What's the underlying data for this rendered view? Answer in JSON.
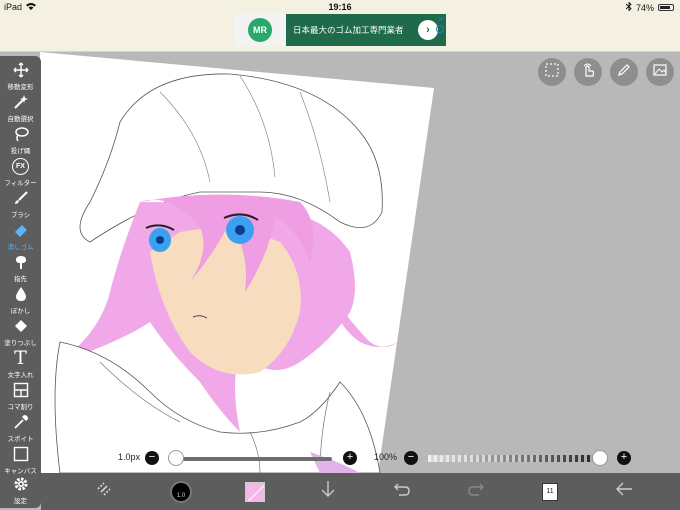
{
  "status_bar": {
    "device": "iPad",
    "time": "19:16",
    "battery": "74%"
  },
  "ad": {
    "logo": "MR",
    "text": "日本最大のゴム加工専門業者",
    "go": "›",
    "close": "✕",
    "info": "i"
  },
  "left_toolbar": {
    "tools": [
      {
        "label": "移動変形",
        "icon": "move-icon"
      },
      {
        "label": "自動選択",
        "icon": "magic-wand-icon"
      },
      {
        "label": "投げ縄",
        "icon": "lasso-icon"
      },
      {
        "label": "フィルター",
        "icon": "filter-icon",
        "icon_text": "FX"
      },
      {
        "label": "ブラシ",
        "icon": "brush-icon"
      },
      {
        "label": "消しゴム",
        "icon": "eraser-icon"
      },
      {
        "label": "指先",
        "icon": "finger-icon"
      },
      {
        "label": "ぼかし",
        "icon": "blur-icon"
      },
      {
        "label": "塗りつぶし",
        "icon": "fill-icon"
      },
      {
        "label": "文字入れ",
        "icon": "text-icon",
        "icon_text": "T"
      },
      {
        "label": "コマ割り",
        "icon": "frame-divider-icon"
      },
      {
        "label": "スポイト",
        "icon": "eyedropper-icon"
      },
      {
        "label": "キャンバス",
        "icon": "canvas-icon"
      },
      {
        "label": "設定",
        "icon": "settings-icon"
      }
    ],
    "active_tool": "消しゴム",
    "active_color": "#5ab8f8"
  },
  "top_tools": [
    {
      "icon": "selection-icon"
    },
    {
      "icon": "hand-gesture-icon"
    },
    {
      "icon": "pen-icon"
    },
    {
      "icon": "image-icon"
    }
  ],
  "brush_size": {
    "label": "1.0px",
    "value": 0.0,
    "minus": "−",
    "plus": "+"
  },
  "opacity": {
    "label": "100%",
    "value": 1.0,
    "minus": "−",
    "plus": "+"
  },
  "bottom_bar": {
    "brush_size_label": "1.0",
    "color": "#f4b8e4",
    "layer_count": "11"
  },
  "colors": {
    "toolbar": "#5d5d5d",
    "canvas_bg": "#b8b8b8",
    "hair": "#f0a8e8",
    "skin": "#f8dcc0",
    "eyes": "#3aa0f0"
  }
}
